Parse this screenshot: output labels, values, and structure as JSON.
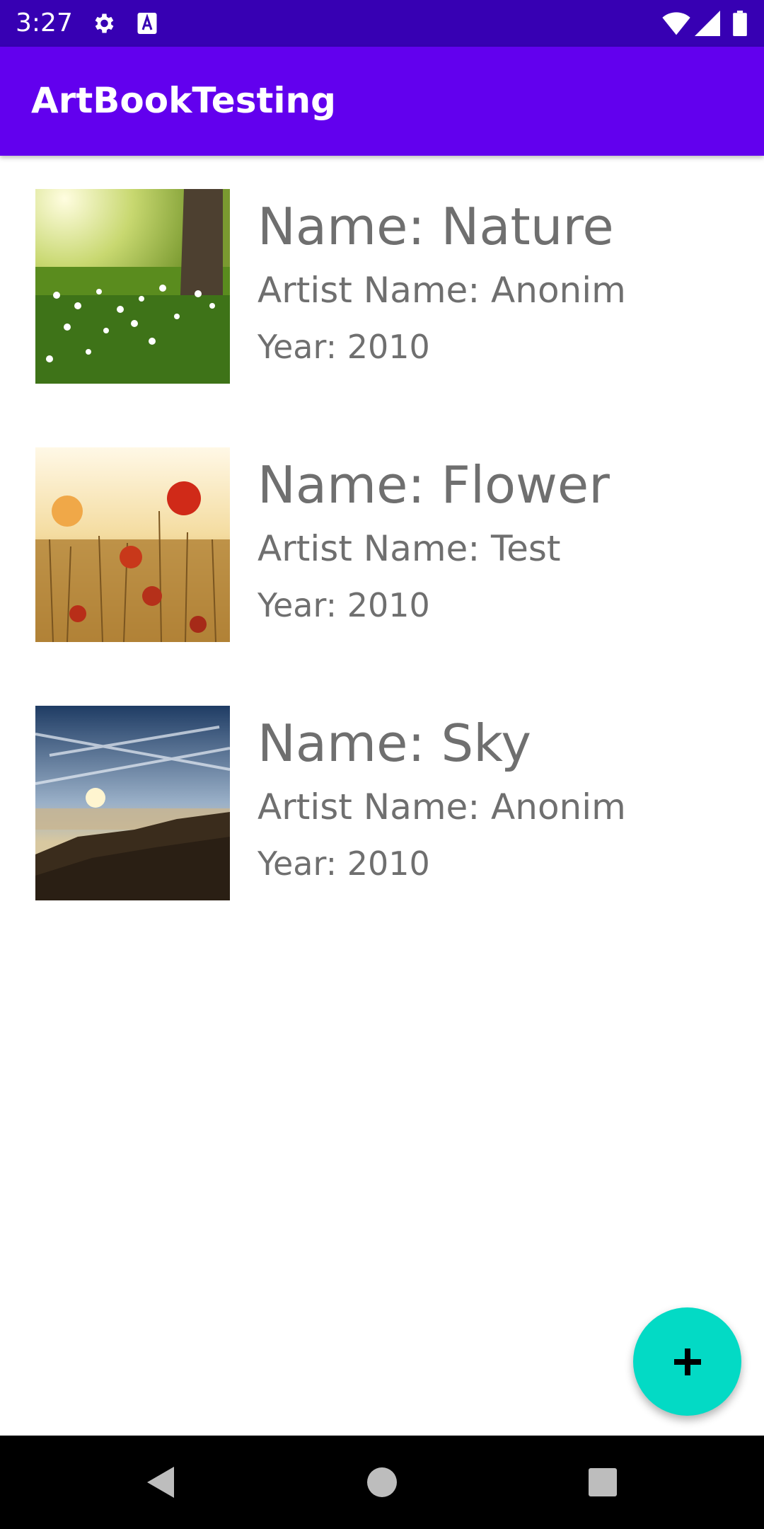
{
  "status_bar": {
    "time": "3:27",
    "icons": [
      "settings-icon",
      "keyboard-a-icon",
      "wifi-icon",
      "signal-icon",
      "battery-icon"
    ]
  },
  "app_bar": {
    "title": "ArtBookTesting"
  },
  "art_list": [
    {
      "name": "Name: Nature",
      "artist": "Artist Name: Anonim",
      "year": "Year: 2010",
      "thumbnail": "nature-photo"
    },
    {
      "name": "Name: Flower",
      "artist": "Artist Name: Test",
      "year": "Year: 2010",
      "thumbnail": "flower-photo"
    },
    {
      "name": "Name: Sky",
      "artist": "Artist Name: Anonim",
      "year": "Year: 2010",
      "thumbnail": "sky-photo"
    }
  ],
  "fab": {
    "icon": "plus-icon"
  },
  "nav_bar": {
    "icons": [
      "back-icon",
      "home-icon",
      "recents-icon"
    ]
  },
  "colors": {
    "status_bar": "#3700b3",
    "app_bar": "#6200ee",
    "fab": "#03dac5",
    "text": "#6f6f6f"
  }
}
